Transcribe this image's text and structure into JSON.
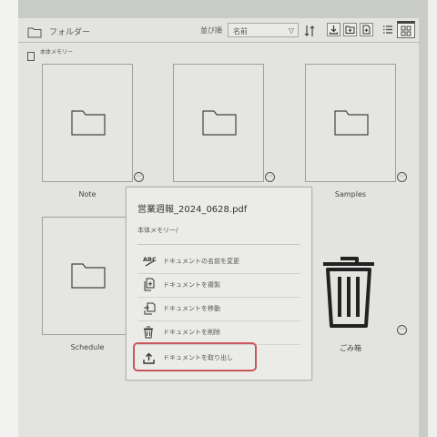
{
  "toolbar": {
    "title": "フォルダー",
    "sort_label": "並び順",
    "sort_value": "名前",
    "sort_arrow": "▽"
  },
  "breadcrumb": {
    "text": "本体メモリー"
  },
  "tiles": [
    {
      "label": "Note",
      "more": "⋯"
    },
    {
      "label": "",
      "more": "⋯"
    },
    {
      "label": "Samples",
      "more": "⋯"
    },
    {
      "label": "Schedule",
      "more": "⋯"
    },
    {
      "label": "ごみ箱",
      "more": "⋯"
    }
  ],
  "popup": {
    "file_name": "営業週報_2024_0628.pdf",
    "path": "本体メモリー/",
    "items": [
      {
        "label": "ドキュメントの名前を変更",
        "icon": "rename-abc-icon"
      },
      {
        "label": "ドキュメントを複製",
        "icon": "duplicate-icon"
      },
      {
        "label": "ドキュメントを移動",
        "icon": "move-icon"
      },
      {
        "label": "ドキュメントを削除",
        "icon": "trash-icon"
      },
      {
        "label": "ドキュメントを取り出し",
        "icon": "export-icon"
      }
    ]
  },
  "colors": {
    "highlight": "#c9565b",
    "screen": "#e3e4e0"
  }
}
